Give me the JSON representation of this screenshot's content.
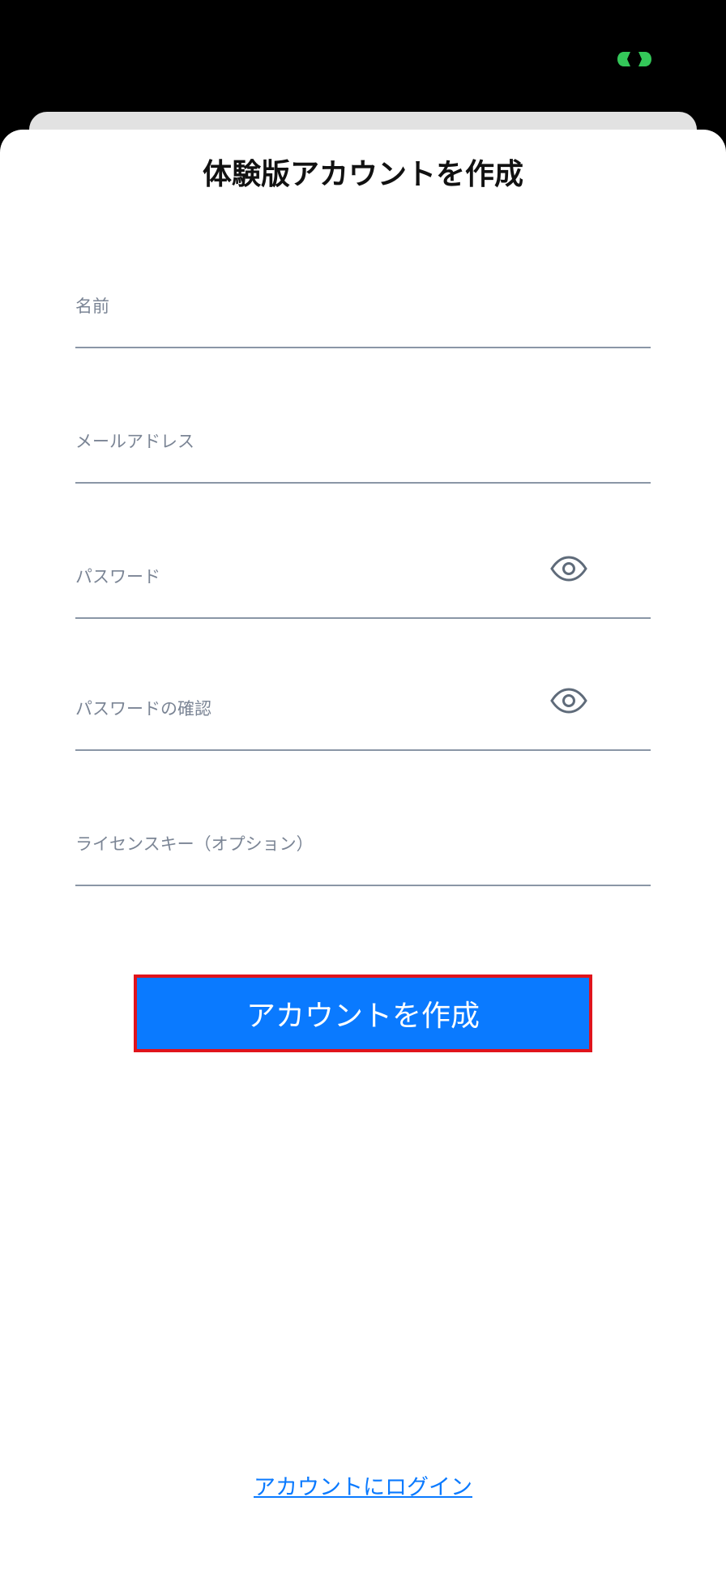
{
  "status_bar": {
    "icon": "link-icon",
    "icon_color": "#34c759"
  },
  "sheet": {
    "title": "体験版アカウントを作成"
  },
  "form": {
    "name_label": "名前",
    "email_label": "メールアドレス",
    "password_label": "パスワード",
    "password_confirm_label": "パスワードの確認",
    "license_key_label": "ライセンスキー（オプション）",
    "password_visibility_icon": "eye-icon"
  },
  "actions": {
    "create_account_label": "アカウントを作成",
    "login_link_label": "アカウントにログイン"
  },
  "colors": {
    "primary": "#0a7aff",
    "highlight_border": "#e0141c",
    "field_label": "#7b8595",
    "field_underline": "#8a96a6"
  }
}
